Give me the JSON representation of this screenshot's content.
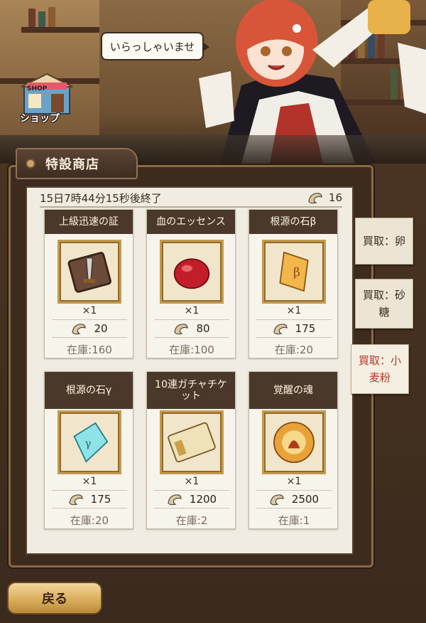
{
  "speech_bubble": "いらっしゃいませ",
  "shop": {
    "label": "ショップ",
    "sign": "SHOP"
  },
  "panel": {
    "title": "特設商店",
    "timer": "15日7時44分15秒後終了",
    "currency_count": "16"
  },
  "items": [
    {
      "name": "上級迅速の証",
      "quantity": "×1",
      "price": "20",
      "stock": "在庫:160",
      "icon": "speed-badge-icon"
    },
    {
      "name": "血のエッセンス",
      "quantity": "×1",
      "price": "80",
      "stock": "在庫:100",
      "icon": "blood-essence-icon"
    },
    {
      "name": "根源の石β",
      "quantity": "×1",
      "price": "175",
      "stock": "在庫:20",
      "icon": "origin-stone-beta-icon"
    },
    {
      "name": "根源の石γ",
      "quantity": "×1",
      "price": "175",
      "stock": "在庫:20",
      "icon": "origin-stone-gamma-icon"
    },
    {
      "name": "10連ガチャチケット",
      "quantity": "×1",
      "price": "1200",
      "stock": "在庫:2",
      "icon": "gacha-ticket-icon"
    },
    {
      "name": "覚醒の魂",
      "quantity": "×1",
      "price": "2500",
      "stock": "在庫:1",
      "icon": "awakening-soul-icon"
    }
  ],
  "side_tabs": [
    {
      "label": "買取：卵",
      "active": false
    },
    {
      "label": "買取：砂糖",
      "active": false
    },
    {
      "label": "買取：小麦粉",
      "active": true
    }
  ],
  "back_button": "戻る",
  "colors": {
    "card_header": "#4a382b",
    "active_tab_text": "#b0392a",
    "button_gold": "#d9ae5c"
  }
}
